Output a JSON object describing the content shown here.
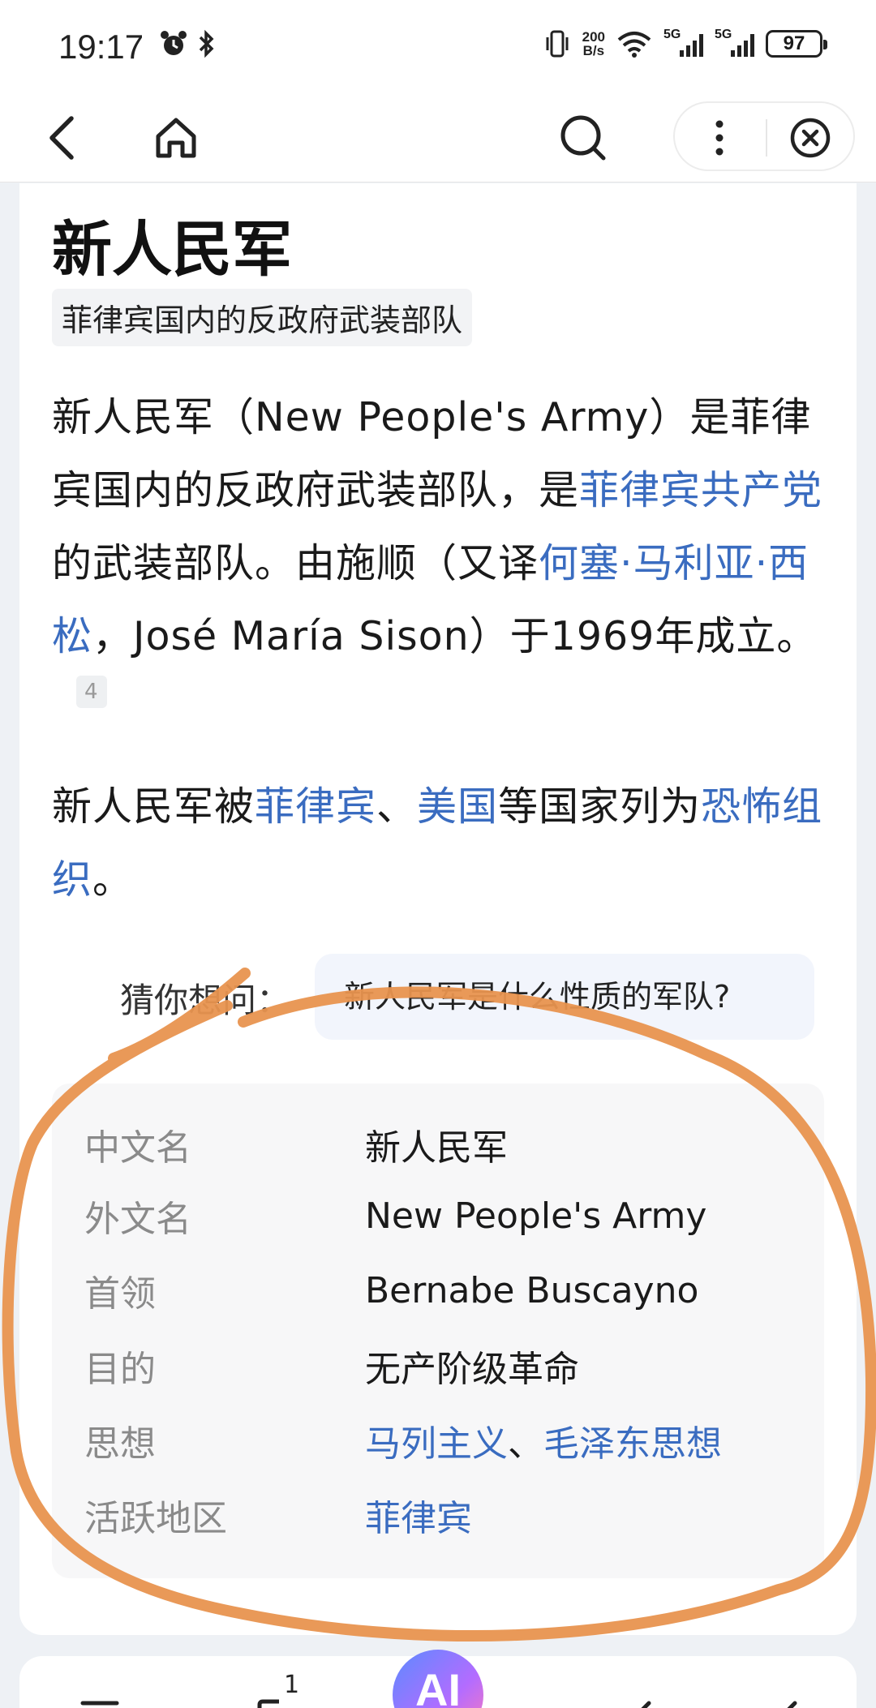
{
  "status_bar": {
    "time": "19:17",
    "net_speed_value": "200",
    "net_speed_unit": "B/s",
    "signal1_label": "5G",
    "signal2_label": "5G",
    "battery": "97"
  },
  "nav": {
    "back_icon": "chevron-left-icon",
    "home_icon": "home-icon",
    "search_icon": "search-icon",
    "more_icon": "more-vertical-icon",
    "close_icon": "close-circle-icon"
  },
  "article": {
    "title": "新人民军",
    "subtitle": "菲律宾国内的反政府武装部队",
    "para1": {
      "t1": "新人民军（New People's Army）是菲律宾国内的反政府武装部队，是",
      "link1": "菲律宾共产党",
      "t2": "的武装部队。由施顺（又译",
      "link2": "何塞·马利亚·西松",
      "t3": "，José María Sison）于1969年成立。",
      "ref": "4"
    },
    "para2": {
      "t1": "新人民军被",
      "link1": "菲律宾",
      "sep": "、",
      "link2": "美国",
      "t2": "等国家列为",
      "link3": "恐怖组织",
      "t3": "。"
    }
  },
  "guess": {
    "label": "猜你想问：",
    "question": "新人民军是什么性质的军队?"
  },
  "infobox": {
    "rows": [
      {
        "key": "中文名",
        "value": "新人民军"
      },
      {
        "key": "外文名",
        "value": "New People's Army"
      },
      {
        "key": "首领",
        "value": "Bernabe Buscayno"
      },
      {
        "key": "目的",
        "value": "无产阶级革命"
      },
      {
        "key": "思想",
        "link1": "马列主义",
        "sep": "、",
        "link2": "毛泽东思想"
      },
      {
        "key": "活跃地区",
        "link1": "菲律宾"
      }
    ]
  },
  "bottom": {
    "ai_label": "AI",
    "tab_count": "1"
  },
  "colors": {
    "link": "#3a6cc0",
    "annotation": "#e8944f"
  }
}
